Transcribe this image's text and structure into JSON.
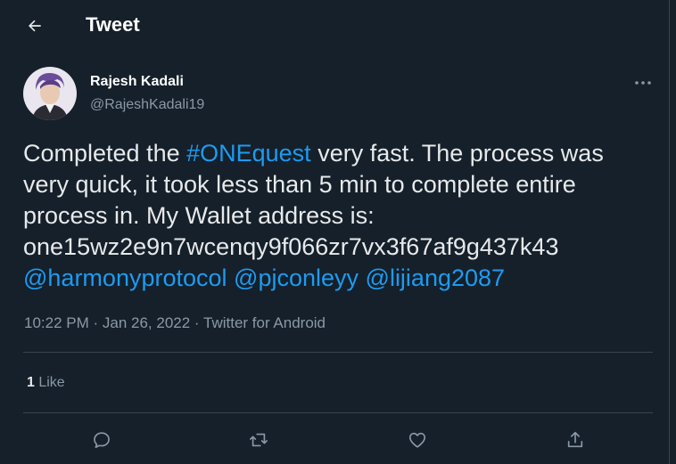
{
  "header": {
    "title": "Tweet",
    "back_icon": "arrow-left-icon"
  },
  "author": {
    "display_name": "Rajesh Kadali",
    "handle": "@RajeshKadali19"
  },
  "tweet": {
    "line1_prefix": "Completed the ",
    "hashtag": "#ONEquest",
    "line1_suffix": " very fast. The process was",
    "line2": "very quick, it took less than 5 min to complete entire",
    "line3": "process in. My Wallet address is:",
    "line4": "one15wz2e9n7wcenqy9f066zr7vx3f67af9g437k43",
    "mentions": [
      "@harmonyprotocol",
      "@pjconleyy",
      "@lijiang2087"
    ]
  },
  "meta": {
    "time": "10:22 PM",
    "sep1": " · ",
    "date": "Jan 26, 2022",
    "sep2": " · ",
    "source": "Twitter for Android"
  },
  "stats": {
    "like_count": "1",
    "like_label": " Like"
  },
  "actions": [
    "reply-icon",
    "retweet-icon",
    "like-icon",
    "share-icon"
  ],
  "colors": {
    "background": "#15202b",
    "accent": "#1d9bf0",
    "secondary_text": "#8b98a5",
    "border": "#38444d"
  }
}
